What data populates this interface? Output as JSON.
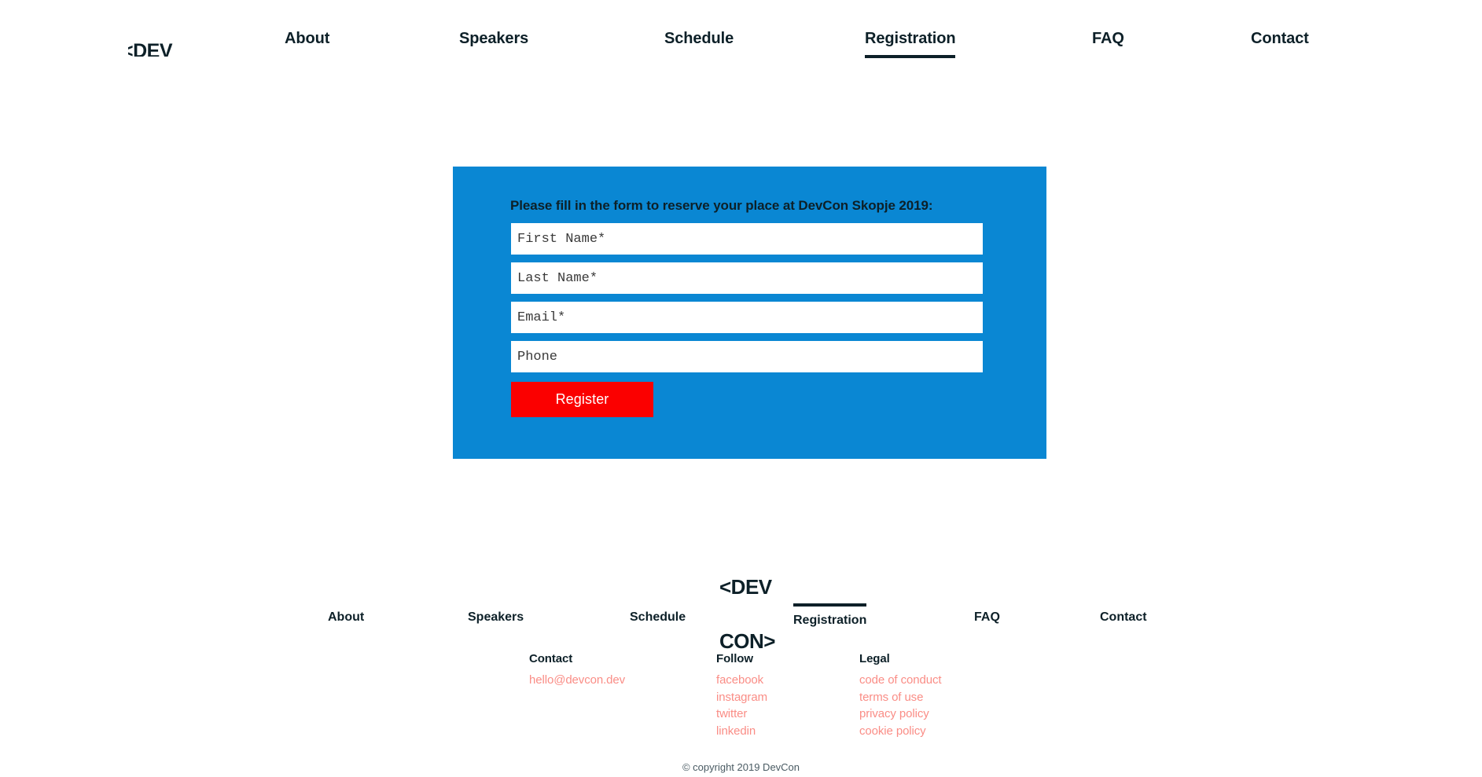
{
  "brand": {
    "logo_line1": "<DEV",
    "logo_line2": "CON>"
  },
  "header": {
    "nav": [
      {
        "label": "About",
        "active": false
      },
      {
        "label": "Speakers",
        "active": false
      },
      {
        "label": "Schedule",
        "active": false
      },
      {
        "label": "Registration",
        "active": true
      },
      {
        "label": "FAQ",
        "active": false
      },
      {
        "label": "Contact",
        "active": false
      }
    ]
  },
  "form": {
    "heading": "Please fill in the form to reserve your place at DevCon Skopje 2019:",
    "panel_color": "#0a87d3",
    "fields": [
      {
        "name": "first-name",
        "placeholder": "First Name*",
        "value": ""
      },
      {
        "name": "last-name",
        "placeholder": "Last Name*",
        "value": ""
      },
      {
        "name": "email",
        "placeholder": "Email*",
        "value": ""
      },
      {
        "name": "phone",
        "placeholder": "Phone",
        "value": ""
      }
    ],
    "submit_label": "Register",
    "submit_color": "#fb0000"
  },
  "footer": {
    "nav": [
      {
        "label": "About",
        "active": false
      },
      {
        "label": "Speakers",
        "active": false
      },
      {
        "label": "Schedule",
        "active": false
      },
      {
        "label": "Registration",
        "active": true
      },
      {
        "label": "FAQ",
        "active": false
      },
      {
        "label": "Contact",
        "active": false
      }
    ],
    "columns": {
      "contact": {
        "title": "Contact",
        "links": [
          "hello@devcon.dev"
        ]
      },
      "follow": {
        "title": "Follow",
        "links": [
          "facebook",
          "instagram",
          "twitter",
          "linkedin"
        ]
      },
      "legal": {
        "title": "Legal",
        "links": [
          "code of conduct",
          "terms of use",
          "privacy policy",
          "cookie policy"
        ]
      }
    },
    "link_color": "#fa8d86",
    "copyright": "© copyright 2019 DevCon"
  }
}
